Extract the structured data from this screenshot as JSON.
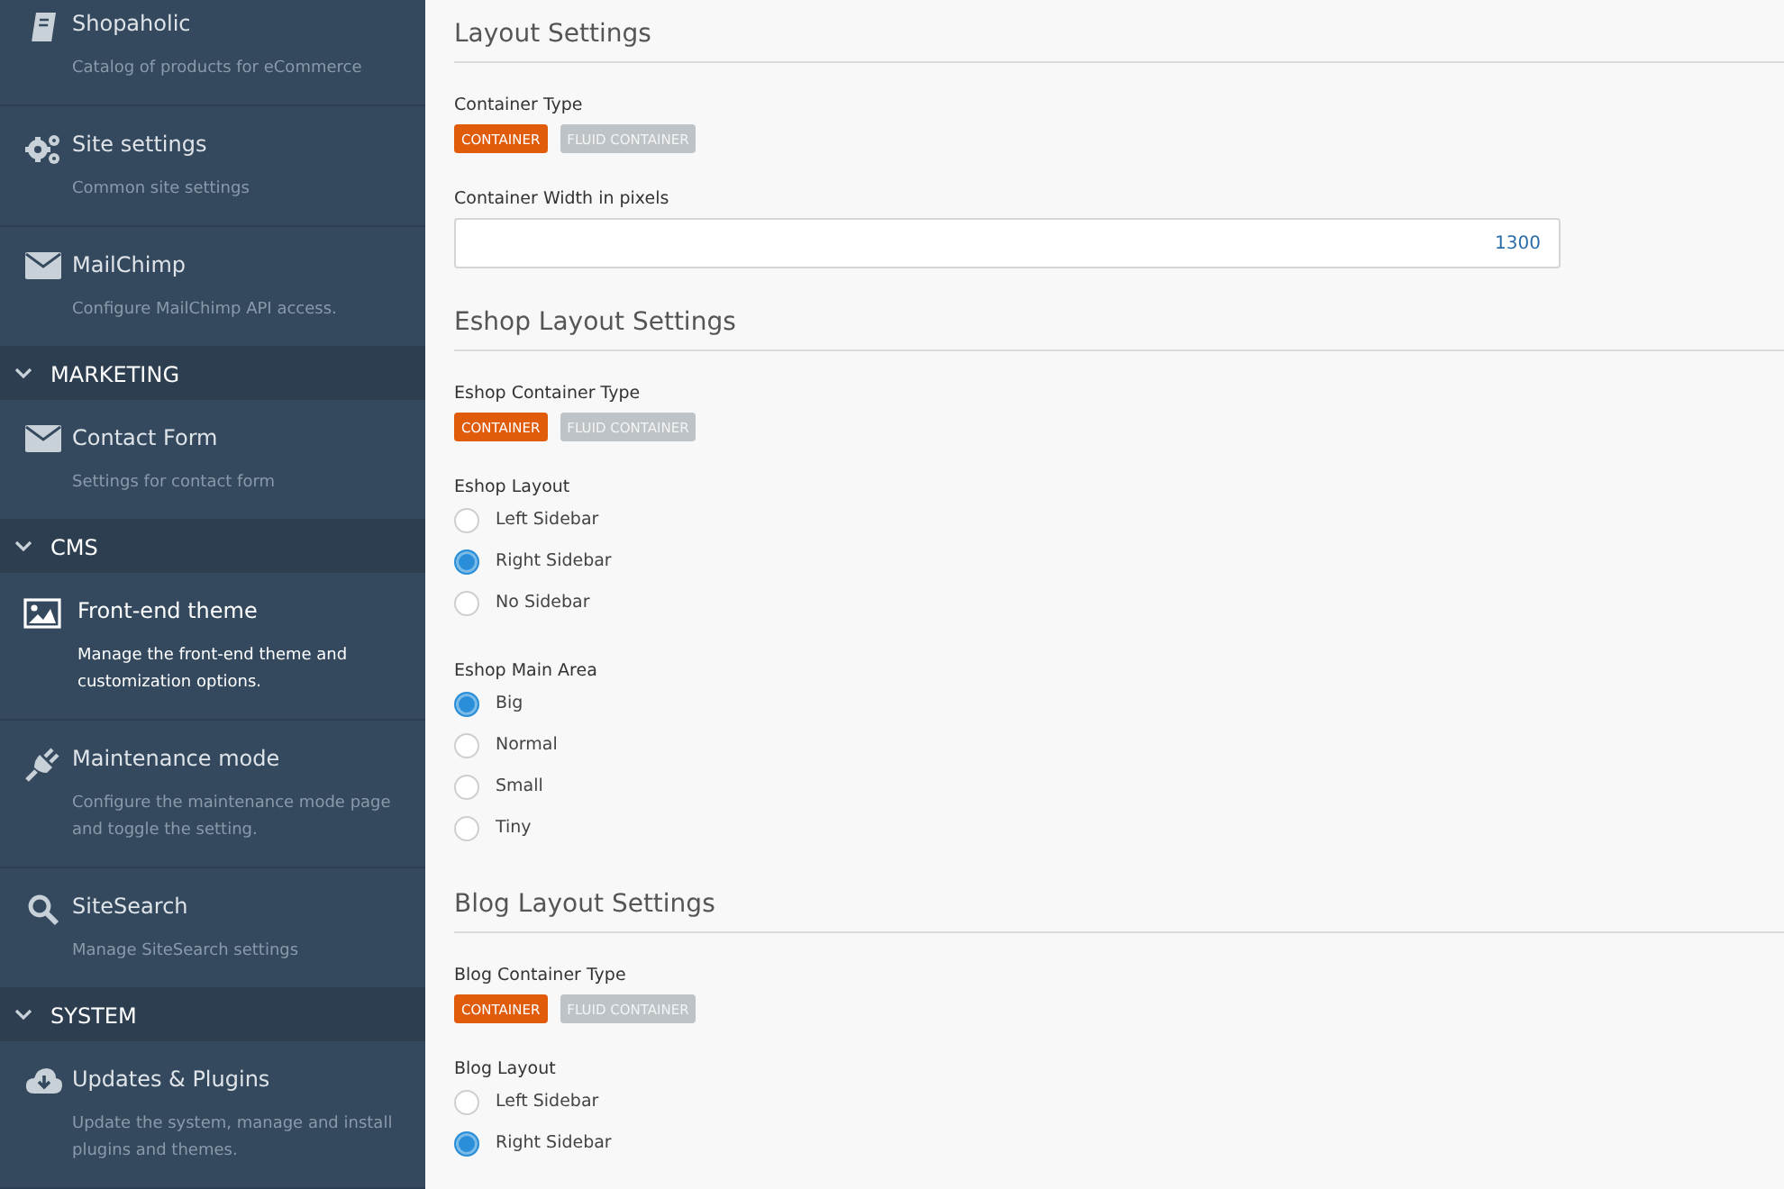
{
  "sidebar": {
    "items": [
      {
        "kind": "item",
        "title": "Shopaholic",
        "description": "Catalog of products for eCommerce",
        "selected": false
      },
      {
        "kind": "item",
        "title": "Site settings",
        "description": "Common site settings",
        "selected": false
      },
      {
        "kind": "item",
        "title": "MailChimp",
        "description": "Configure MailChimp API access.",
        "selected": false
      },
      {
        "kind": "header",
        "title": "MARKETING",
        "expanded": true
      },
      {
        "kind": "item",
        "title": "Contact Form",
        "description": "Settings for contact form",
        "selected": false
      },
      {
        "kind": "header",
        "title": "CMS",
        "expanded": true
      },
      {
        "kind": "item",
        "title": "Front-end theme",
        "description": "Manage the front-end theme and customization options.",
        "selected": true
      },
      {
        "kind": "item",
        "title": "Maintenance mode",
        "description": "Configure the maintenance mode page and toggle the setting.",
        "selected": false
      },
      {
        "kind": "item",
        "title": "SiteSearch",
        "description": "Manage SiteSearch settings",
        "selected": false
      },
      {
        "kind": "header",
        "title": "SYSTEM",
        "expanded": true
      },
      {
        "kind": "item",
        "title": "Updates & Plugins",
        "description": "Update the system, manage and install plugins and themes.",
        "selected": false
      }
    ]
  },
  "sections": [
    {
      "title": "Layout Settings",
      "fields": [
        {
          "kind": "toggle",
          "label": "Container Type",
          "options": [
            {
              "label": "CONTAINER",
              "selected": true
            },
            {
              "label": "FLUID CONTAINER",
              "selected": false
            }
          ]
        },
        {
          "kind": "number",
          "label": "Container Width in pixels",
          "value": "1300"
        }
      ]
    },
    {
      "title": "Eshop Layout Settings",
      "fields": [
        {
          "kind": "toggle",
          "label": "Eshop Container Type",
          "options": [
            {
              "label": "CONTAINER",
              "selected": true
            },
            {
              "label": "FLUID CONTAINER",
              "selected": false
            }
          ]
        },
        {
          "kind": "radio",
          "label": "Eshop Layout",
          "options": [
            {
              "label": "Left Sidebar",
              "selected": false
            },
            {
              "label": "Right Sidebar",
              "selected": true
            },
            {
              "label": "No Sidebar",
              "selected": false
            }
          ]
        },
        {
          "kind": "radio",
          "label": "Eshop Main Area",
          "options": [
            {
              "label": "Big",
              "selected": true
            },
            {
              "label": "Normal",
              "selected": false
            },
            {
              "label": "Small",
              "selected": false
            },
            {
              "label": "Tiny",
              "selected": false
            }
          ]
        }
      ]
    },
    {
      "title": "Blog Layout Settings",
      "fields": [
        {
          "kind": "toggle",
          "label": "Blog Container Type",
          "options": [
            {
              "label": "CONTAINER",
              "selected": true
            },
            {
              "label": "FLUID CONTAINER",
              "selected": false
            }
          ]
        },
        {
          "kind": "radio",
          "label": "Blog Layout",
          "options": [
            {
              "label": "Left Sidebar",
              "selected": false
            },
            {
              "label": "Right Sidebar",
              "selected": true
            }
          ]
        }
      ]
    }
  ]
}
